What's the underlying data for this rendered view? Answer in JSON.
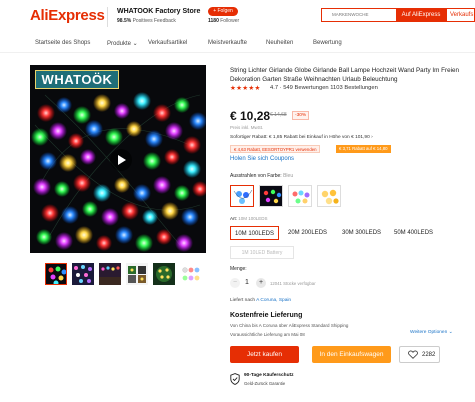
{
  "header": {
    "logo": "AliExpress",
    "store_name": "WHATOOK Factory Store",
    "store_feedback_value": "98.5%",
    "store_feedback_label": "Positives Feedback",
    "follow_label": "+ Folgen",
    "follower_count": "1180",
    "follower_label": "Follower",
    "search_placeholder": "MARKENWOCHE",
    "search_btn_aliexpress": "Auf AliExpress",
    "search_btn_store": "Verkaufs"
  },
  "nav": {
    "items": [
      "Startseite des Shops",
      "Produkte ⌄",
      "Verkaufsartikel",
      "Meistverkaufte",
      "Neuheiten",
      "Bewertung"
    ]
  },
  "gallery": {
    "brand_badge": "WHATOÖK",
    "thumb_count": 6
  },
  "product": {
    "title": "String Lichter Girlande Globe Girlande Ball Lampe Hochzeit Wand Party Im Freien Dekoration Garten Straße Weihnachten Urlaub Beleuchtung",
    "stars": "★★★★★",
    "rating_value": 4.7,
    "rating_text": "4.7 ·  549 Bewertungen  1103 Bestellungen",
    "price": "€ 10,28",
    "old_price": "€ 14,68",
    "discount": "-30%",
    "tax_note": "Preis inkl. MwSt.",
    "instant_discount": "Sofortiger Rabatt: € 1,85 Rabatt bei Einkauf in Höhe von € 101,90 ›",
    "coupon1": "€ 4,63 Rabatt, EESORTOYPR1 verwenden",
    "coupon2": "€ 3,71 Rabatt auf € 14,80",
    "coupons_link": "Holen Sie sich Coupons",
    "color_label": "Ausstrahlen von Farbe:",
    "color_value": "Bleu",
    "art_label": "Art:",
    "art_value": "10M 100LEDS",
    "sizes": [
      "10M 100LEDS",
      "20M 200LEDS",
      "30M 300LEDS",
      "50M 400LEDS",
      "1M 10LED Battery"
    ],
    "quantity_label": "Menge:",
    "quantity": "1",
    "qty_minus": "−",
    "qty_plus": "+",
    "stock": "12041 Stücke verfügbar",
    "ship_to_label": "Liefert nach",
    "ship_to_value": "A Coruna, Spain",
    "shipping_title": "Kostenfreie Lieferung",
    "shipping_from": "Von China bis A Coruna über AliExpress Standard Shipping",
    "shipping_date": "Voraussichtliche Lieferung am Mai 08",
    "more_options": "Weitere Optionen ⌄",
    "buy_now": "Jetzt kaufen",
    "add_to_cart": "In den Einkaufswagen",
    "wishlist_count": "2282",
    "protection_title": "90-Tage Käuferschutz",
    "protection_sub": "Geld-Zurück Garantie"
  },
  "colors": {
    "accent": "#e62e04",
    "cart": "#ff9a1a",
    "link": "#1a73c7"
  },
  "icons": [
    "play-icon",
    "heart-icon",
    "shield-check-icon"
  ]
}
